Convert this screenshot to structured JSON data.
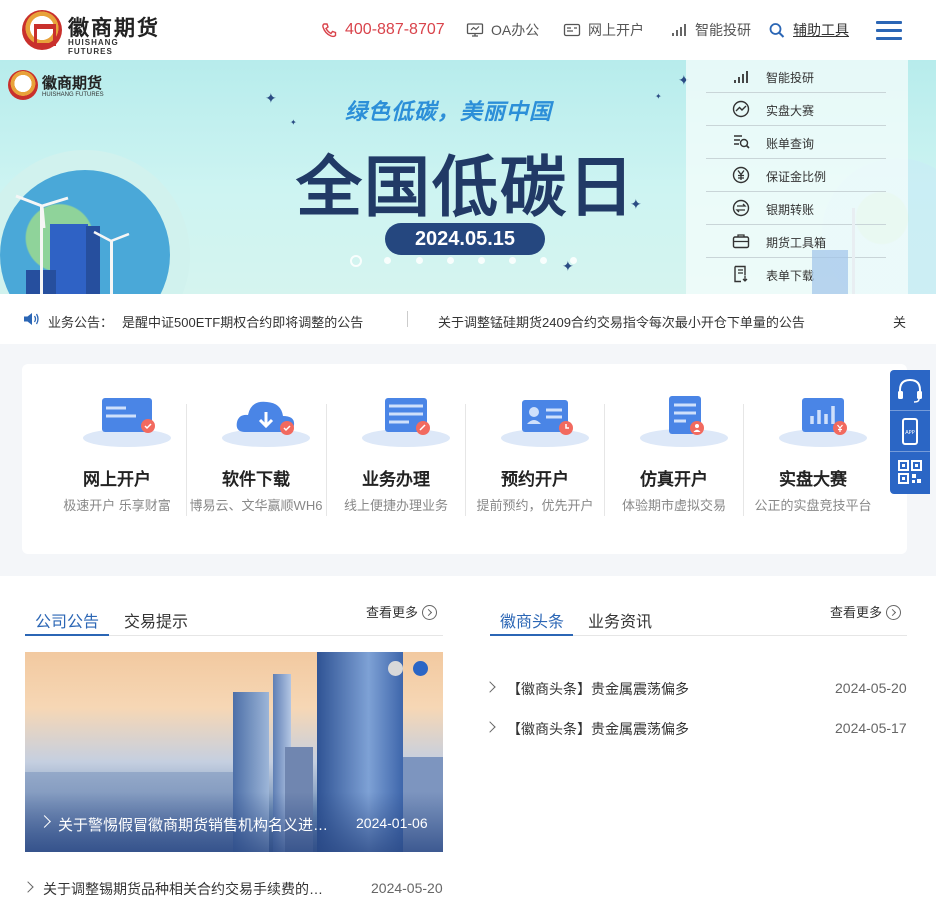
{
  "header": {
    "logo_cn": "徽商期货",
    "logo_en": "HUISHANG FUTURES",
    "phone": "400-887-8707",
    "nav": [
      "OA办公",
      "网上开户",
      "智能投研"
    ],
    "aux_tools": "辅助工具"
  },
  "banner": {
    "logo_cn": "徽商期货",
    "logo_en": "HUISHANG FUTURES",
    "slogan": "绿色低碳，美丽中国",
    "headline": "全国低碳日",
    "date": "2024.05.15",
    "menu": [
      "智能投研",
      "实盘大赛",
      "账单查询",
      "保证金比例",
      "银期转账",
      "期货工具箱",
      "表单下载"
    ]
  },
  "notice": {
    "label": "业务公告：",
    "items": [
      "是醒中证500ETF期权合约即将调整的公告",
      "关于调整锰硅期货2409合约交易指令每次最小开仓下单量的公告",
      "关"
    ]
  },
  "services": [
    {
      "name": "网上开户",
      "desc": "极速开户 乐享财富"
    },
    {
      "name": "软件下载",
      "desc": "博易云、文华赢顺WH6"
    },
    {
      "name": "业务办理",
      "desc": "线上便捷办理业务"
    },
    {
      "name": "预约开户",
      "desc": "提前预约，优先开户"
    },
    {
      "name": "仿真开户",
      "desc": "体验期市虚拟交易"
    },
    {
      "name": "实盘大赛",
      "desc": "公正的实盘竞技平台"
    }
  ],
  "news_left": {
    "tabs": [
      "公司公告",
      "交易提示"
    ],
    "more": "查看更多",
    "featured": {
      "title": "关于警惕假冒徽商期货销售机构名义进行诈骗的风险提示",
      "date": "2024-01-06"
    },
    "items": [
      {
        "title": "关于调整锡期货品种相关合约交易手续费的公告",
        "date": "2024-05-20"
      }
    ]
  },
  "news_right": {
    "tabs": [
      "徽商头条",
      "业务资讯"
    ],
    "more": "查看更多",
    "items": [
      {
        "title": "【徽商头条】贵金属震荡偏多",
        "date": "2024-05-20"
      },
      {
        "title": "【徽商头条】贵金属震荡偏多",
        "date": "2024-05-17"
      }
    ]
  },
  "colors": {
    "brand_blue": "#2b66b5",
    "phone_red": "#d9434b",
    "banner_navy": "#213a66"
  }
}
